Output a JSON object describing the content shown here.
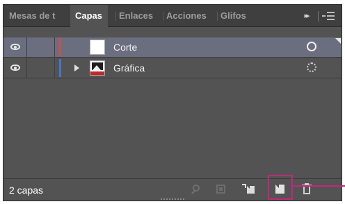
{
  "tabs": [
    {
      "label": "Mesas de t",
      "active": false
    },
    {
      "label": "Capas",
      "active": true
    },
    {
      "label": "Enlaces",
      "active": false
    },
    {
      "label": "Acciones",
      "active": false
    },
    {
      "label": "Glifos",
      "active": false
    }
  ],
  "tabbar": {
    "overflow_label": "▸▸",
    "overflow_icon": "double-chevron-right-icon",
    "menu_icon": "panel-menu-icon"
  },
  "layers": [
    {
      "name": "Corte",
      "visible": true,
      "selected": true,
      "expandable": false,
      "color": "#d24a4a",
      "thumbnail": "blank"
    },
    {
      "name": "Gráfica",
      "visible": true,
      "selected": false,
      "expandable": true,
      "color": "#4a72c8",
      "thumbnail": "image"
    }
  ],
  "status": {
    "layer_count": "2 capas"
  },
  "bottom_actions": [
    {
      "name": "locate-object",
      "icon": "magnifier-icon",
      "enabled": false
    },
    {
      "name": "make-clipping-mask",
      "icon": "clipping-mask-icon",
      "enabled": false
    },
    {
      "name": "create-new-sublayer",
      "icon": "new-sublayer-icon",
      "enabled": true
    },
    {
      "name": "create-new-layer",
      "icon": "new-layer-icon",
      "enabled": true,
      "highlighted": true
    },
    {
      "name": "delete-selection",
      "icon": "trash-icon",
      "enabled": true
    }
  ],
  "colors": {
    "panel_bg": "#535353",
    "tabbar_bg": "#3f3f3f",
    "selected_row": "#6b6e7e",
    "callout": "#c0297c"
  }
}
